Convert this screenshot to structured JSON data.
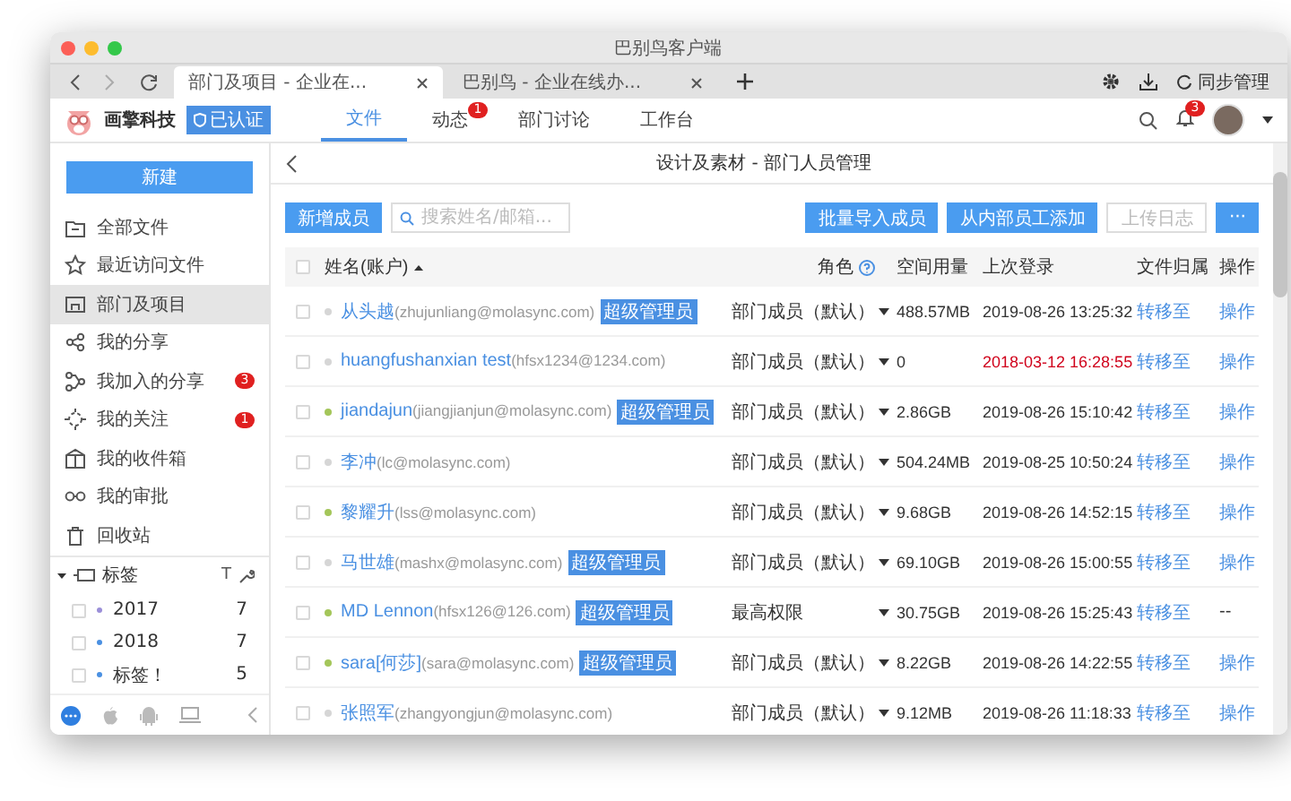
{
  "window": {
    "title": "巴别鸟客户端"
  },
  "browser_tabs": [
    {
      "label": "部门及项目 - 企业在...",
      "selected": true
    },
    {
      "label": "巴别鸟 - 企业在线办...",
      "selected": false
    }
  ],
  "browser_toolbar": {
    "sync": "同步管理"
  },
  "app_header": {
    "company": "画擎科技",
    "verified": "已认证",
    "notification_count": "3",
    "nav": [
      {
        "label": "文件",
        "selected": true
      },
      {
        "label": "动态",
        "selected": false,
        "badge": "1"
      },
      {
        "label": "部门讨论",
        "selected": false
      },
      {
        "label": "工作台",
        "selected": false
      }
    ]
  },
  "sidebar": {
    "new_button": "新建",
    "items": [
      {
        "label": "全部文件",
        "selected": false
      },
      {
        "label": "最近访问文件",
        "selected": false
      },
      {
        "label": "部门及项目",
        "selected": true
      },
      {
        "label": "我的分享",
        "selected": false
      },
      {
        "label": "我加入的分享",
        "selected": false,
        "badge": "3"
      },
      {
        "label": "我的关注",
        "selected": false,
        "badge": "1"
      },
      {
        "label": "我的收件箱",
        "selected": false
      },
      {
        "label": "我的审批",
        "selected": false
      },
      {
        "label": "回收站",
        "selected": false
      }
    ],
    "tags": {
      "title": "标签",
      "expanded": true,
      "filter": "T",
      "items": [
        {
          "label": "2017",
          "count": "7",
          "color": "#9b8fd8",
          "checked": false
        },
        {
          "label": "2018",
          "count": "7",
          "color": "#4a90e2",
          "checked": false
        },
        {
          "label": "标签！",
          "count": "5",
          "color": "#4a90e2",
          "checked": false
        }
      ]
    }
  },
  "page": {
    "title": "设计及素材 - 部门人员管理",
    "add_button": "新增成员",
    "search": {
      "placeholder": "搜索姓名/邮箱..."
    },
    "buttons": [
      {
        "label": "批量导入成员",
        "disabled": false
      },
      {
        "label": "从内部员工添加",
        "disabled": false
      },
      {
        "label": "上传日志",
        "disabled": true
      },
      {
        "label": "···",
        "disabled": false
      }
    ],
    "table": {
      "all_checked": false,
      "columns": [
        "姓名(账户)",
        "角色",
        "空间用量",
        "上次登录",
        "文件归属",
        "操作"
      ],
      "rows": [
        {
          "checked": false,
          "online": false,
          "name": "从头越",
          "account": "(zhujunliang@molasync.com)",
          "badge": "超级管理员",
          "role": "部门成员（默认）",
          "usage": "488.57MB",
          "last_login": "2019-08-26 13:25:32",
          "stale": false,
          "owner": "转移至",
          "action": "操作"
        },
        {
          "checked": false,
          "online": false,
          "name": "huangfushanxian test",
          "account": "(hfsx1234@1234.com)",
          "role": "部门成员（默认）",
          "usage": "0",
          "last_login": "2018-03-12 16:28:55",
          "stale": true,
          "owner": "转移至",
          "action": "操作"
        },
        {
          "checked": false,
          "online": true,
          "name": "jiandajun",
          "account": "(jiangjianjun@molasync.com)",
          "badge": "超级管理员",
          "role": "部门成员（默认）",
          "usage": "2.86GB",
          "last_login": "2019-08-26 15:10:42",
          "stale": false,
          "owner": "转移至",
          "action": "操作"
        },
        {
          "checked": false,
          "online": false,
          "name": "李冲",
          "account": "(lc@molasync.com)",
          "role": "部门成员（默认）",
          "usage": "504.24MB",
          "last_login": "2019-08-25 10:50:24",
          "stale": false,
          "owner": "转移至",
          "action": "操作"
        },
        {
          "checked": false,
          "online": true,
          "name": "黎耀升",
          "account": "(lss@molasync.com)",
          "role": "部门成员（默认）",
          "usage": "9.68GB",
          "last_login": "2019-08-26 14:52:15",
          "stale": false,
          "owner": "转移至",
          "action": "操作"
        },
        {
          "checked": false,
          "online": false,
          "name": "马世雄",
          "account": "(mashx@molasync.com)",
          "badge": "超级管理员",
          "role": "部门成员（默认）",
          "usage": "69.10GB",
          "last_login": "2019-08-26 15:00:55",
          "stale": false,
          "owner": "转移至",
          "action": "操作"
        },
        {
          "checked": false,
          "online": true,
          "name": "MD Lennon",
          "account": "(hfsx126@126.com)",
          "badge": "超级管理员",
          "role": "最高权限",
          "usage": "30.75GB",
          "last_login": "2019-08-26 15:25:43",
          "stale": false,
          "owner": "转移至",
          "action": "--"
        },
        {
          "checked": false,
          "online": true,
          "name": "sara[何莎]",
          "account": "(sara@molasync.com)",
          "badge": "超级管理员",
          "role": "部门成员（默认）",
          "usage": "8.22GB",
          "last_login": "2019-08-26 14:22:55",
          "stale": false,
          "owner": "转移至",
          "action": "操作"
        },
        {
          "checked": false,
          "online": false,
          "name": "张照军",
          "account": "(zhangyongjun@molasync.com)",
          "role": "部门成员（默认）",
          "usage": "9.12MB",
          "last_login": "2019-08-26 11:18:33",
          "stale": false,
          "owner": "转移至",
          "action": "操作"
        }
      ]
    }
  }
}
